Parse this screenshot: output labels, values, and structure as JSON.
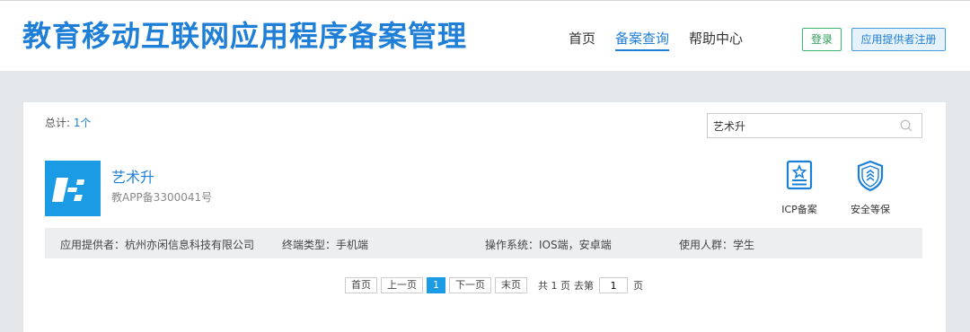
{
  "header": {
    "site_title": "教育移动互联网应用程序备案管理",
    "nav": [
      "首页",
      "备案查询",
      "帮助中心"
    ],
    "login": "登录",
    "register": "应用提供者注册"
  },
  "results": {
    "total_label": "总计:",
    "total_count": "1个",
    "search_value": "艺术升"
  },
  "app": {
    "name": "艺术升",
    "record_no": "教APP备3300041号",
    "badges": [
      "ICP备案",
      "安全等保"
    ],
    "provider": "应用提供者：杭州亦闲信息科技有限公司",
    "terminal": "终端类型：手机端",
    "os": "操作系统：IOS端，安卓端",
    "audience": "使用人群：学生"
  },
  "pager": {
    "first": "首页",
    "prev": "上一页",
    "current": "1",
    "next": "下一页",
    "last": "末页",
    "total_pages": "共 1 页",
    "goto_label": "去第",
    "goto_value": "1",
    "page_suffix": "页"
  },
  "colors": {
    "brand_blue": "#1f7fd6",
    "logo_blue": "#1a9be3",
    "login_green": "#3cb371"
  }
}
